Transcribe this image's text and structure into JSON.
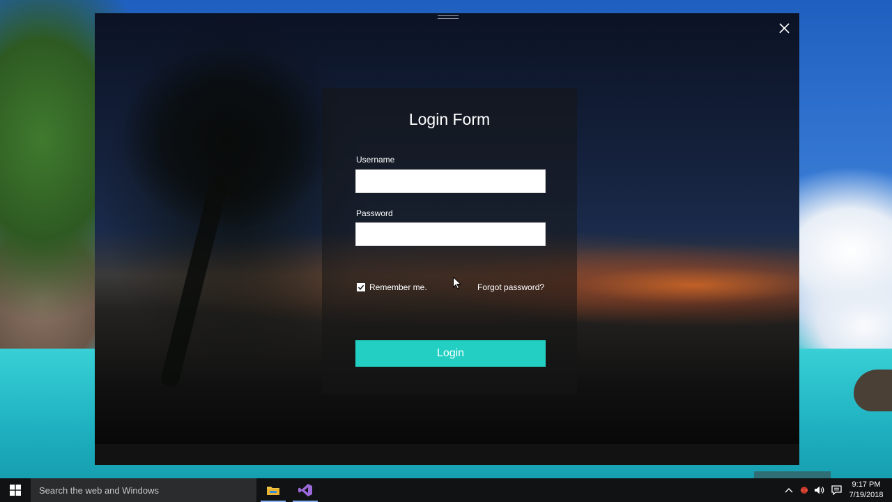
{
  "window": {
    "close_icon": "close-icon"
  },
  "login": {
    "title": "Login Form",
    "username_label": "Username",
    "username_value": "",
    "password_label": "Password",
    "password_value": "",
    "remember_label": "Remember me.",
    "remember_checked": true,
    "forgot_label": "Forgot password?",
    "button_label": "Login",
    "accent_color": "#22cfc2"
  },
  "taskbar": {
    "search_placeholder": "Search the web and Windows",
    "apps": [
      "file-explorer-icon",
      "visual-studio-icon"
    ],
    "time": "9:17 PM",
    "date": "7/19/2018"
  }
}
